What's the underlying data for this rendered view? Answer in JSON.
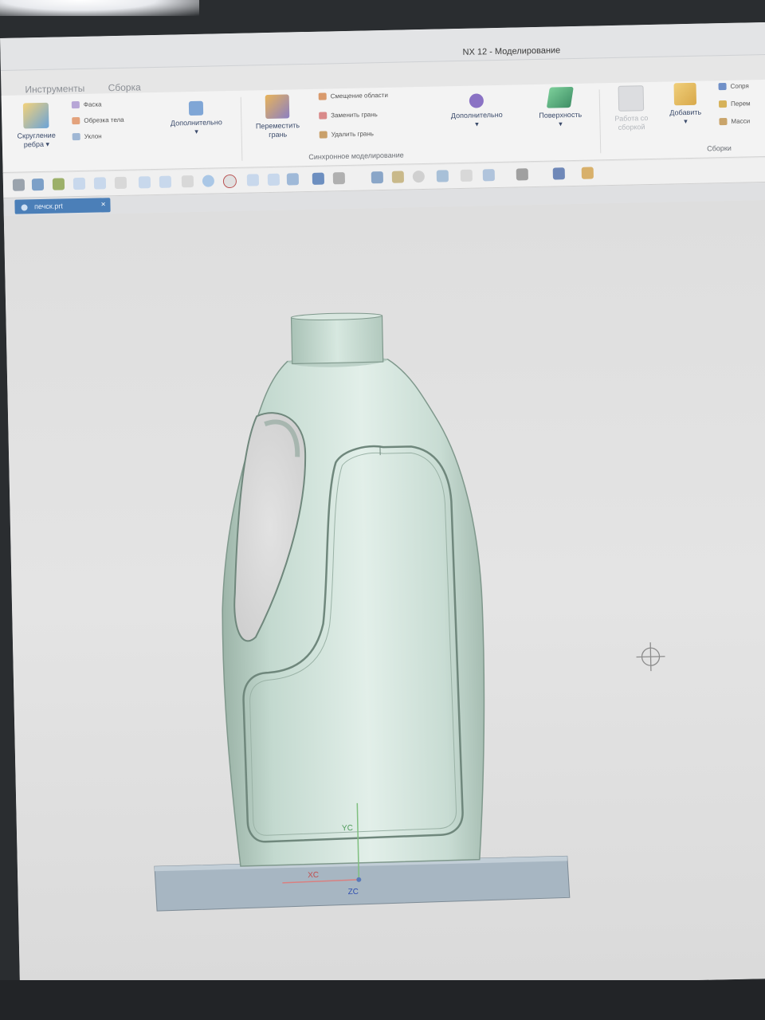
{
  "window": {
    "title": "NX 12 - Моделирование"
  },
  "menu_tabs": [
    "Инструменты",
    "Сборка"
  ],
  "ribbon": {
    "edge_blend": {
      "label_line1": "Скругление",
      "label_line2": "ребра",
      "arrow": "▾"
    },
    "feature_small": [
      {
        "label": "Фаска",
        "icon": "chamfer-icon"
      },
      {
        "label": "Обрезка тела",
        "icon": "trim-body-icon"
      },
      {
        "label": "Уклон",
        "icon": "draft-icon"
      }
    ],
    "more1": {
      "label": "Дополнительно",
      "arrow": "▾"
    },
    "move_face": {
      "label_line1": "Переместить",
      "label_line2": "грань"
    },
    "sync_small": [
      {
        "label": "Смещение области",
        "icon": "offset-region-icon"
      },
      {
        "label": "Заменить грань",
        "icon": "replace-face-icon"
      },
      {
        "label": "Удалить грань",
        "icon": "delete-face-icon"
      }
    ],
    "sync_group_label": "Синхронное моделирование",
    "more2": {
      "label": "Дополнительно",
      "arrow": "▾"
    },
    "surface": {
      "label": "Поверхность",
      "arrow": "▾"
    },
    "work_in_assembly": {
      "label_line1": "Работа со",
      "label_line2": "сборкой"
    },
    "add": {
      "label": "Добавить",
      "arrow": "▾"
    },
    "assembly_small": [
      {
        "label": "Сопря",
        "icon": "constraint-icon"
      },
      {
        "label": "Перем",
        "icon": "move-component-icon"
      },
      {
        "label": "Масси",
        "icon": "pattern-icon"
      }
    ],
    "assembly_group_label": "Сборки"
  },
  "file_tab": {
    "name": "печск.prt",
    "close": "×"
  },
  "axes": {
    "yc": "YC",
    "xc": "XC",
    "zc": "ZC"
  },
  "colors": {
    "body_light": "#dcebe4",
    "body_mid": "#c3d9cf",
    "body_dark": "#9cb4a8",
    "base": "#a9b8c4",
    "accent_blue": "#4b7fb8"
  }
}
